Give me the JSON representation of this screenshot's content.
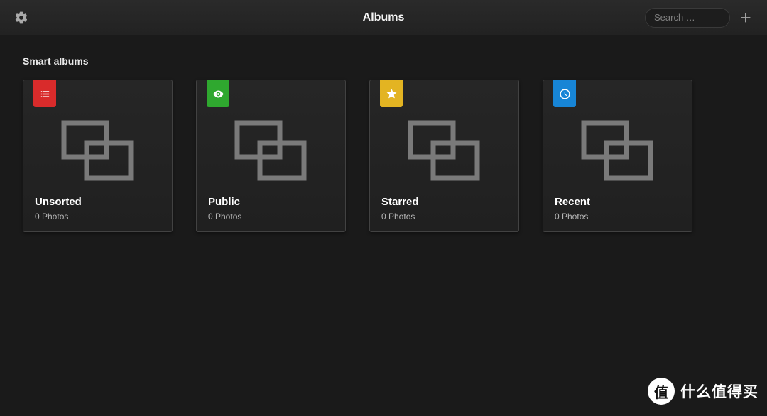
{
  "header": {
    "title": "Albums",
    "search_placeholder": "Search …"
  },
  "section": {
    "title": "Smart albums"
  },
  "albums": [
    {
      "title": "Unsorted",
      "count": "0 Photos",
      "badge_color": "#d92b2b",
      "badge_icon": "list"
    },
    {
      "title": "Public",
      "count": "0 Photos",
      "badge_color": "#2fa82f",
      "badge_icon": "eye"
    },
    {
      "title": "Starred",
      "count": "0 Photos",
      "badge_color": "#e3b422",
      "badge_icon": "star"
    },
    {
      "title": "Recent",
      "count": "0 Photos",
      "badge_color": "#1785d6",
      "badge_icon": "clock"
    }
  ],
  "watermark": {
    "circle": "值",
    "text": "什么值得买"
  }
}
